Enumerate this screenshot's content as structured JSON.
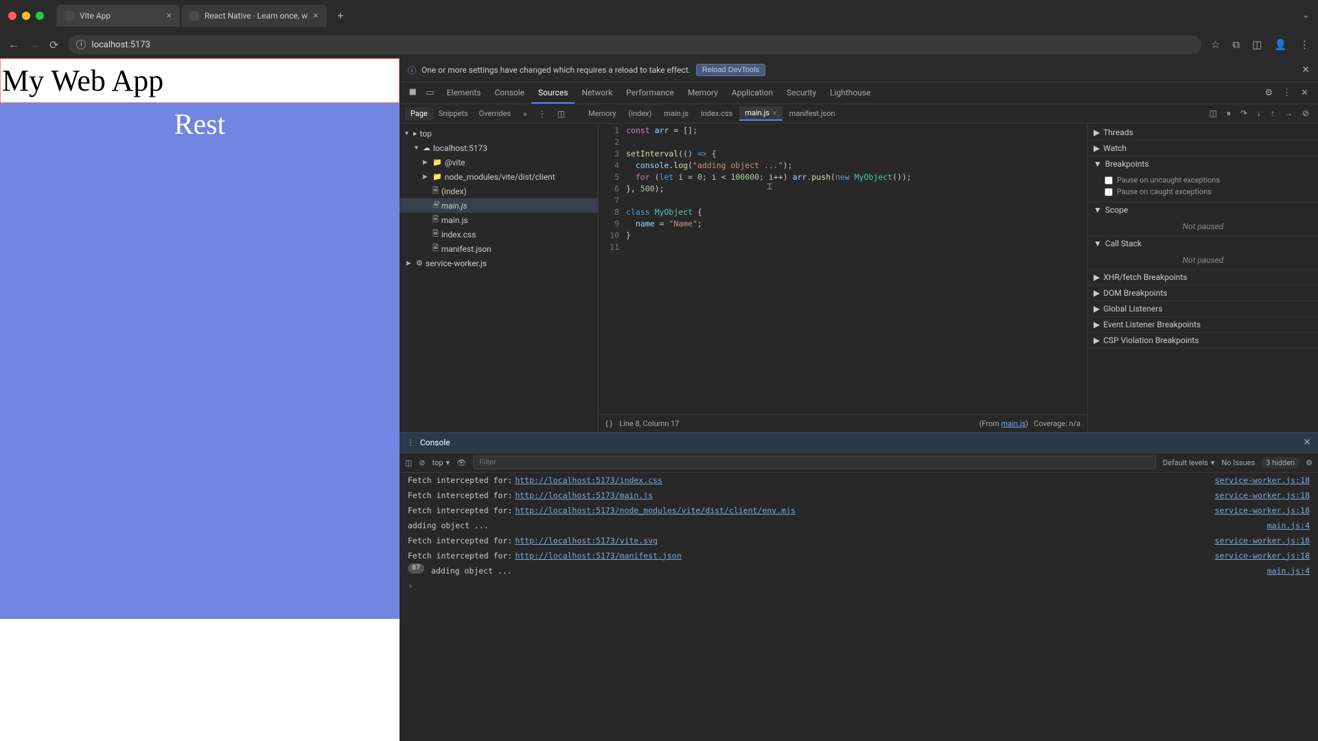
{
  "browser": {
    "tabs": [
      {
        "title": "Vite App",
        "active": true
      },
      {
        "title": "React Native · Learn once, w",
        "active": false
      }
    ],
    "url": "localhost:5173"
  },
  "page": {
    "heading": "My Web App",
    "subhead": "Rest"
  },
  "banner": {
    "text": "One or more settings have changed which requires a reload to take effect.",
    "button": "Reload DevTools"
  },
  "devtools_tabs": [
    "Elements",
    "Console",
    "Sources",
    "Network",
    "Performance",
    "Memory",
    "Application",
    "Security",
    "Lighthouse"
  ],
  "devtools_active_tab": "Sources",
  "sources_subtabs": [
    "Page",
    "Snippets",
    "Overrides"
  ],
  "file_tabs": [
    "Memory",
    "(index)",
    "main.js",
    "index.css",
    "main.js",
    "manifest.json"
  ],
  "file_tabs_active_index": 4,
  "tree": {
    "top": "top",
    "host": "localhost:5173",
    "vite": "@vite",
    "nm": "node_modules/vite/dist/client",
    "files": [
      "(index)",
      "main.js",
      "main.js",
      "index.css",
      "manifest.json"
    ],
    "selected_index": 1,
    "sw": "service-worker.js"
  },
  "code_lines": [
    {
      "n": 1,
      "html": "<span class='tok-kw'>const</span> <span class='tok-name'>arr</span> = [];"
    },
    {
      "n": 2,
      "html": ""
    },
    {
      "n": 3,
      "html": "<span class='tok-fn'>setInterval</span>(() <span class='tok-def'>=&gt;</span> {"
    },
    {
      "n": 4,
      "html": "  <span class='tok-name'>console</span>.<span class='tok-fn'>log</span>(<span class='tok-str'>\"adding object ...\"</span>);"
    },
    {
      "n": 5,
      "html": "  <span class='tok-kw'>for</span> (<span class='tok-def'>let</span> <span class='tok-name'>i</span> = <span class='tok-num'>0</span>; <span class='tok-name'>i</span> &lt; <span class='tok-num'>100000</span>; <span class='tok-name'>i</span>++) <span class='tok-name'>arr</span>.<span class='tok-fn'>push</span>(<span class='tok-def'>new</span> <span class='tok-cls'>MyObject</span>());"
    },
    {
      "n": 6,
      "html": "}, <span class='tok-num'>500</span>);"
    },
    {
      "n": 7,
      "html": ""
    },
    {
      "n": 8,
      "html": "<span class='tok-def'>class</span> <span class='tok-cls'>MyObject</span> {"
    },
    {
      "n": 9,
      "html": "  <span class='tok-name'>name</span> = <span class='tok-str'>\"Name\"</span>;"
    },
    {
      "n": 10,
      "html": "}"
    },
    {
      "n": 11,
      "html": ""
    }
  ],
  "status": {
    "pos": "Line 8, Column 17",
    "from_prefix": "(From ",
    "from_link": "main.js",
    "from_suffix": ")",
    "coverage": "Coverage: n/a"
  },
  "debugger": {
    "threads": "Threads",
    "watch": "Watch",
    "breakpoints": "Breakpoints",
    "bp_uncaught": "Pause on uncaught exceptions",
    "bp_caught": "Pause on caught exceptions",
    "scope": "Scope",
    "not_paused": "Not paused",
    "call_stack": "Call Stack",
    "xhr": "XHR/fetch Breakpoints",
    "dom": "DOM Breakpoints",
    "global": "Global Listeners",
    "event": "Event Listener Breakpoints",
    "csp": "CSP Violation Breakpoints"
  },
  "console": {
    "title": "Console",
    "context": "top",
    "filter_placeholder": "Filter",
    "levels": "Default levels",
    "no_issues": "No Issues",
    "hidden": "3 hidden",
    "log_count": "87",
    "logs": [
      {
        "prefix": "Fetch intercepted for: ",
        "link": "http://localhost:5173/index.css",
        "src": "service-worker.js:18"
      },
      {
        "prefix": "Fetch intercepted for: ",
        "link": "http://localhost:5173/main.js",
        "src": "service-worker.js:18"
      },
      {
        "prefix": "Fetch intercepted for: ",
        "link": "http://localhost:5173/node_modules/vite/dist/client/env.mjs",
        "src": "service-worker.js:18"
      },
      {
        "prefix": "adding object ...",
        "link": "",
        "src": "main.js:4"
      },
      {
        "prefix": "Fetch intercepted for: ",
        "link": "http://localhost:5173/vite.svg",
        "src": "service-worker.js:18"
      },
      {
        "prefix": "Fetch intercepted for: ",
        "link": "http://localhost:5173/manifest.json",
        "src": "service-worker.js:18"
      }
    ],
    "repeated_msg": "adding object ...",
    "repeated_src": "main.js:4"
  }
}
